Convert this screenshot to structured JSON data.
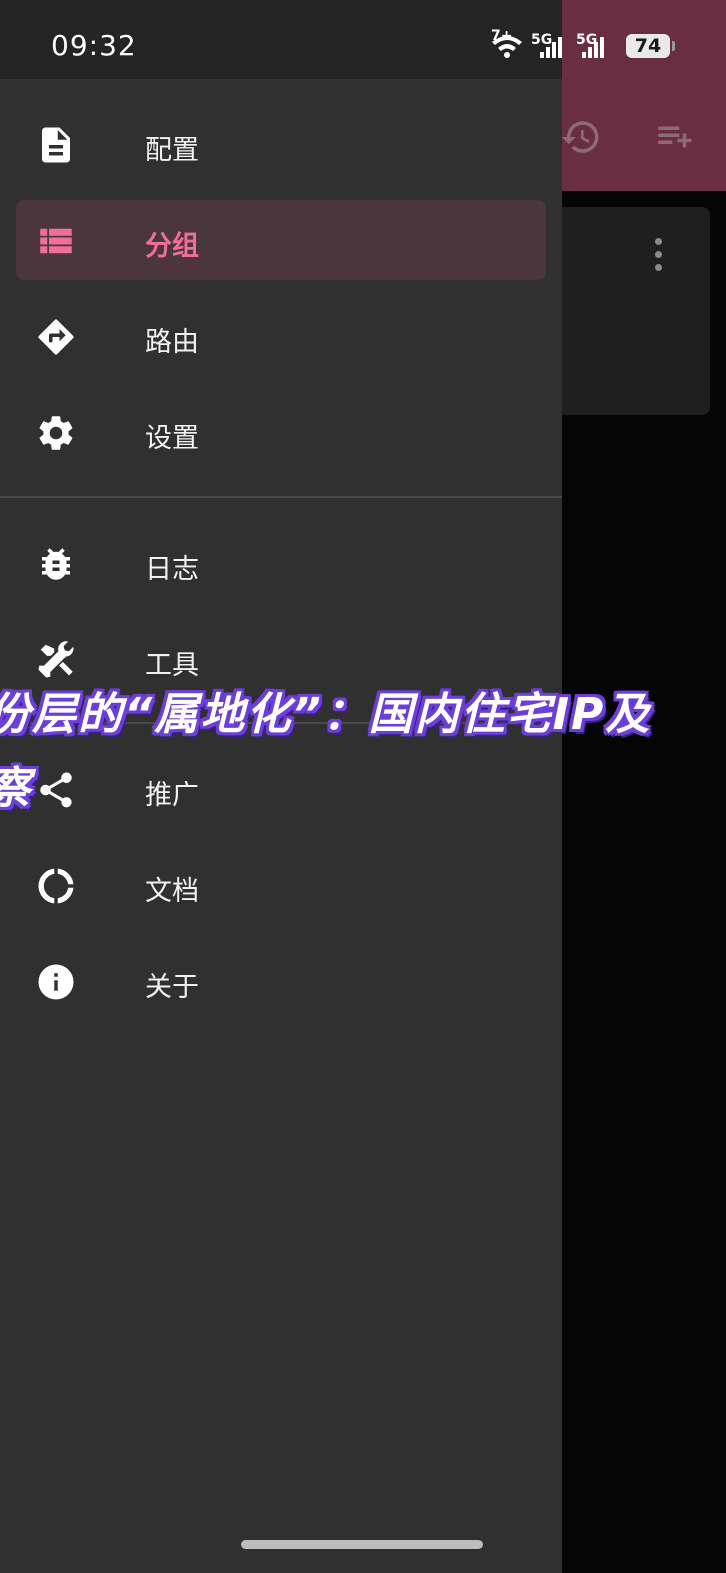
{
  "status_bar": {
    "time": "09:32",
    "wifi_badge": "7+",
    "sim1": "5G",
    "sim2": "5G",
    "battery": "74"
  },
  "drawer": {
    "items": [
      {
        "label": "配置",
        "icon": "file-document-icon",
        "active": false
      },
      {
        "label": "分组",
        "icon": "list-icon",
        "active": true
      },
      {
        "label": "路由",
        "icon": "route-directions-icon",
        "active": false
      },
      {
        "label": "设置",
        "icon": "gear-icon",
        "active": false
      },
      {
        "label": "日志",
        "icon": "bug-icon",
        "active": false
      },
      {
        "label": "工具",
        "icon": "tools-icon",
        "active": false
      },
      {
        "label": "推广",
        "icon": "share-icon",
        "active": false
      },
      {
        "label": "文档",
        "icon": "donut-loading-icon",
        "active": false
      },
      {
        "label": "关于",
        "icon": "info-icon",
        "active": false
      }
    ]
  },
  "overlay": {
    "line1": "份层的“属地化”：国内住宅IP及",
    "line2": "察"
  },
  "colors": {
    "accent": "#f06f9a",
    "drawer_bg": "#303030",
    "toolbar_bg": "#6a2e43",
    "active_bg": "#4a363c"
  }
}
